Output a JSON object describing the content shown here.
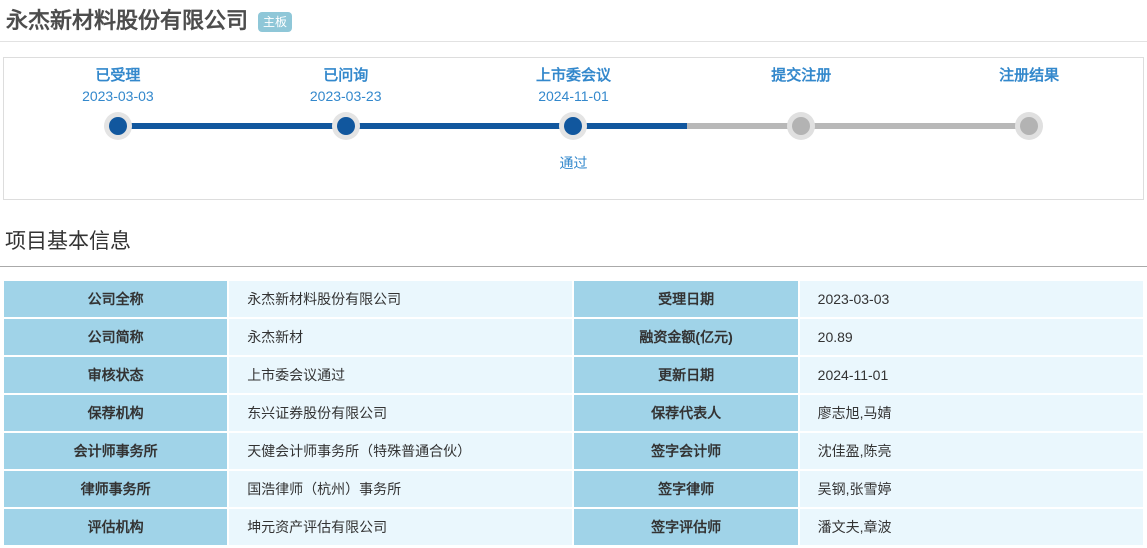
{
  "header": {
    "title": "永杰新材料股份有限公司",
    "board_badge": "主板"
  },
  "timeline": {
    "stages": [
      {
        "label": "已受理",
        "date": "2023-03-03",
        "note": "",
        "state": "done"
      },
      {
        "label": "已问询",
        "date": "2023-03-23",
        "note": "",
        "state": "done"
      },
      {
        "label": "上市委会议",
        "date": "2024-11-01",
        "note": "通过",
        "state": "done"
      },
      {
        "label": "提交注册",
        "date": "",
        "note": "",
        "state": "pending"
      },
      {
        "label": "注册结果",
        "date": "",
        "note": "",
        "state": "pending"
      }
    ],
    "progress_fraction": 0.625
  },
  "section_title": "项目基本信息",
  "info_table": {
    "rows": [
      [
        {
          "label": "公司全称",
          "value": "永杰新材料股份有限公司"
        },
        {
          "label": "受理日期",
          "value": "2023-03-03"
        }
      ],
      [
        {
          "label": "公司简称",
          "value": "永杰新材"
        },
        {
          "label": "融资金额(亿元)",
          "value": "20.89"
        }
      ],
      [
        {
          "label": "审核状态",
          "value": "上市委会议通过"
        },
        {
          "label": "更新日期",
          "value": "2024-11-01"
        }
      ],
      [
        {
          "label": "保荐机构",
          "value": "东兴证券股份有限公司"
        },
        {
          "label": "保荐代表人",
          "value": "廖志旭,马婧"
        }
      ],
      [
        {
          "label": "会计师事务所",
          "value": "天健会计师事务所（特殊普通合伙）"
        },
        {
          "label": "签字会计师",
          "value": "沈佳盈,陈亮"
        }
      ],
      [
        {
          "label": "律师事务所",
          "value": "国浩律师（杭州）事务所"
        },
        {
          "label": "签字律师",
          "value": "吴钢,张雪婷"
        }
      ],
      [
        {
          "label": "评估机构",
          "value": "坤元资产评估有限公司"
        },
        {
          "label": "签字评估师",
          "value": "潘文夫,章波"
        }
      ]
    ]
  },
  "colors": {
    "accent_blue": "#3388cc",
    "done_blue": "#11579e",
    "pending_gray": "#b3b3b3",
    "badge_bg": "#8fc7d8",
    "label_cell_bg": "#a0d3e8",
    "value_cell_bg": "#eaf7fd"
  }
}
